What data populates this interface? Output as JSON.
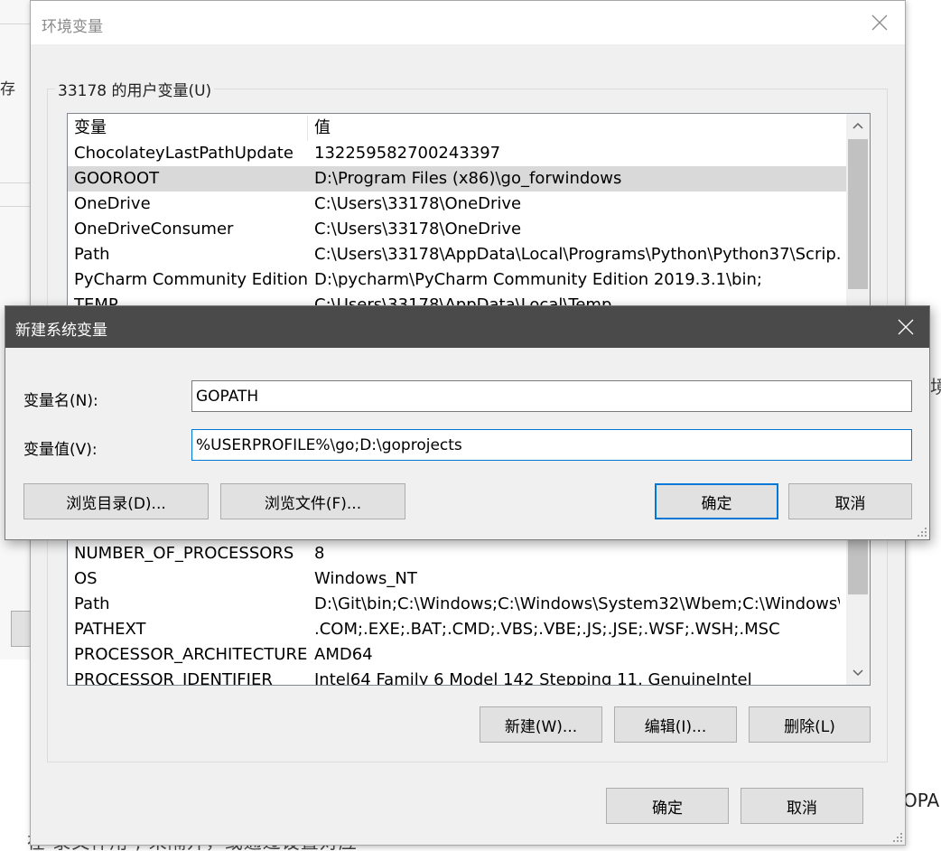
{
  "background": {
    "left_char": "存",
    "right_char": "境",
    "right_text": "OPA",
    "bottom_text": "在    录文件用 ; 来隔开，或通过设置对应"
  },
  "env_window": {
    "title": "环境变量",
    "user_vars": {
      "group_label": "33178 的用户变量(U)",
      "headers": [
        "变量",
        "值"
      ],
      "rows": [
        {
          "name": "ChocolateyLastPathUpdate",
          "value": "132259582700243397"
        },
        {
          "name": "GOOROOT",
          "value": "D:\\Program Files (x86)\\go_forwindows",
          "selected": true
        },
        {
          "name": "OneDrive",
          "value": "C:\\Users\\33178\\OneDrive"
        },
        {
          "name": "OneDriveConsumer",
          "value": "C:\\Users\\33178\\OneDrive"
        },
        {
          "name": "Path",
          "value": "C:\\Users\\33178\\AppData\\Local\\Programs\\Python\\Python37\\Scrip..."
        },
        {
          "name": "PyCharm Community Edition",
          "value": "D:\\pycharm\\PyCharm Community Edition 2019.3.1\\bin;"
        },
        {
          "name": "TEMP",
          "value": "C:\\Users\\33178\\AppData\\Local\\Temp"
        }
      ]
    },
    "system_vars": {
      "rows": [
        {
          "name": "NUMBER_OF_PROCESSORS",
          "value": "8"
        },
        {
          "name": "OS",
          "value": "Windows_NT"
        },
        {
          "name": "Path",
          "value": "D:\\Git\\bin;C:\\Windows;C:\\Windows\\System32\\Wbem;C:\\Windows\\..."
        },
        {
          "name": "PATHEXT",
          "value": ".COM;.EXE;.BAT;.CMD;.VBS;.VBE;.JS;.JSE;.WSF;.WSH;.MSC"
        },
        {
          "name": "PROCESSOR_ARCHITECTURE",
          "value": "AMD64"
        },
        {
          "name": "PROCESSOR_IDENTIFIER",
          "value": "Intel64 Family 6 Model 142 Stepping 11, GenuineIntel"
        }
      ],
      "buttons": {
        "new": "新建(W)...",
        "edit": "编辑(I)...",
        "delete": "删除(L)"
      }
    },
    "ok": "确定",
    "cancel": "取消"
  },
  "dialog": {
    "title": "新建系统变量",
    "name_label": "变量名(N):",
    "name_value": "GOPATH",
    "value_label": "变量值(V):",
    "value_value": "%USERPROFILE%\\go;D:\\goprojects",
    "browse_dir": "浏览目录(D)...",
    "browse_file": "浏览文件(F)...",
    "ok": "确定",
    "cancel": "取消"
  }
}
